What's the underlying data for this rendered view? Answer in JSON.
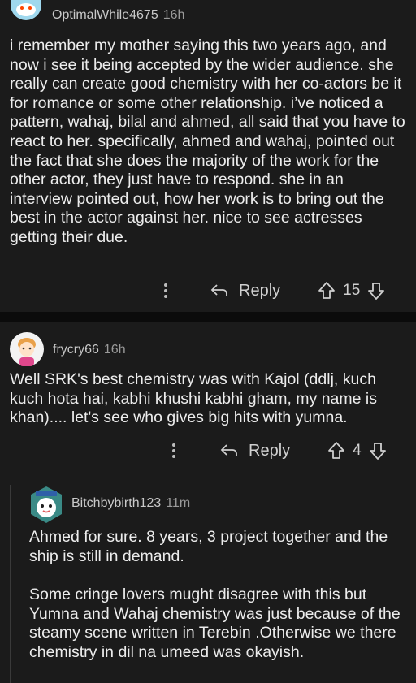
{
  "comments": [
    {
      "author": "OptimalWhile4675",
      "time": "16h",
      "body": [
        "i remember my mother saying this two years ago, and now i see it being accepted by the wider audience. she really can create good chemistry with her co-actors be it for romance or some other relationship. i’ve noticed a pattern, wahaj, bilal and ahmed, all said that you have to react to her. specifically, ahmed and wahaj, pointed out the fact that she does the majority of the work for the other actor, they just have to respond. she in an interview pointed out, how her work is to bring out the best in the actor against her. nice to see actresses getting their due."
      ],
      "reply_label": "Reply",
      "score": "15"
    },
    {
      "author": "frycry66",
      "time": "16h",
      "body": [
        "Well SRK's best chemistry was with Kajol (ddlj, kuch kuch hota hai, kabhi khushi kabhi gham, my name is khan).... let's see who gives big hits with yumna."
      ],
      "reply_label": "Reply",
      "score": "4"
    },
    {
      "author": "Bitchbybirth123",
      "time": "11m",
      "body": [
        "Ahmed for sure. 8 years, 3 project together and the ship is still in demand.",
        "Some cringe lovers mught disagree with this but Yumna and Wahaj chemistry was just because of the steamy scene written in Terebin .Otherwise we there chemistry in dil na umeed was okayish."
      ]
    }
  ],
  "icons": {
    "more": "more-vertical-icon",
    "reply": "reply-arrow-icon",
    "upvote": "upvote-arrow-icon",
    "downvote": "downvote-arrow-icon"
  },
  "colors": {
    "card": "#1b1b1b",
    "background": "#0b0b0b",
    "thread_line": "#3a3a3a"
  }
}
